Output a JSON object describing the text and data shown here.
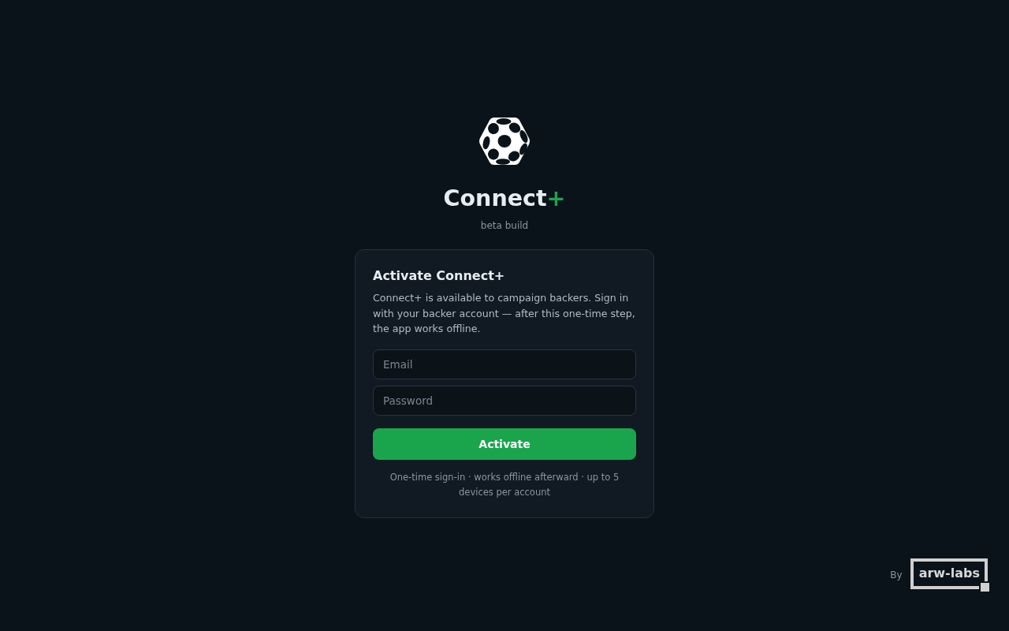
{
  "brand": {
    "name": "Connect",
    "mark": "+",
    "tagline": "beta build"
  },
  "card": {
    "title": "Activate Connect+",
    "description": "Connect+ is available to campaign backers. Sign in with your backer account — after this one-time step, the app works offline.",
    "fields": [
      {
        "placeholder": "Email"
      },
      {
        "placeholder": "Password"
      }
    ],
    "button": "Activate",
    "note": "One-time sign-in · works offline afterward · up to 5 devices per account"
  },
  "footer": {
    "by": "By",
    "maker": "arw-labs"
  }
}
